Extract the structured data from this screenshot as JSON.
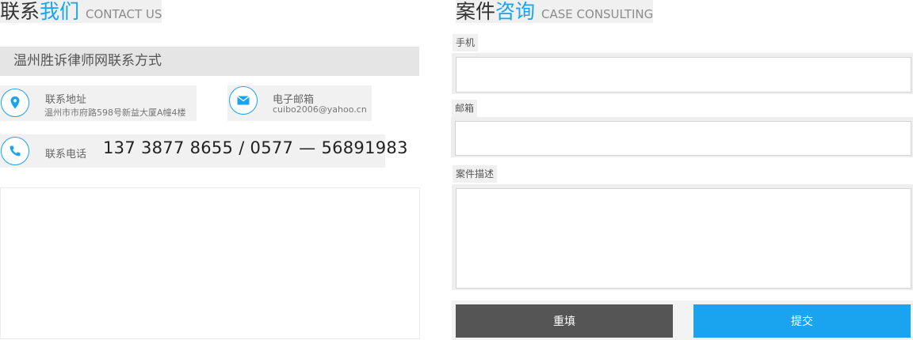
{
  "contact": {
    "title_dark": "联系",
    "title_accent": "我们",
    "title_en": "CONTACT US",
    "office_name": "温州胜诉律师网联系方式",
    "address_label": "联系地址",
    "address_value": "温州市市府路598号新益大厦A幢4楼",
    "email_label": "电子邮箱",
    "email_value": "cuibo2006@yahoo.cn",
    "phone_label": "联系电话",
    "phone_value": "137 3877 8655 / 0577 — 56891983"
  },
  "consult": {
    "title_dark": "案件",
    "title_accent": "咨询",
    "title_en": "CASE CONSULTING",
    "fields": [
      {
        "label": "手机",
        "value": ""
      },
      {
        "label": "邮箱",
        "value": ""
      },
      {
        "label": "案件描述",
        "value": ""
      }
    ],
    "reset_label": "重填",
    "submit_label": "提交"
  },
  "colors": {
    "accent": "#1aa3ee",
    "reset_button": "#555555",
    "submit_button": "#1aa3ee"
  },
  "icons": [
    "location-pin-icon",
    "mail-icon",
    "phone-icon"
  ]
}
